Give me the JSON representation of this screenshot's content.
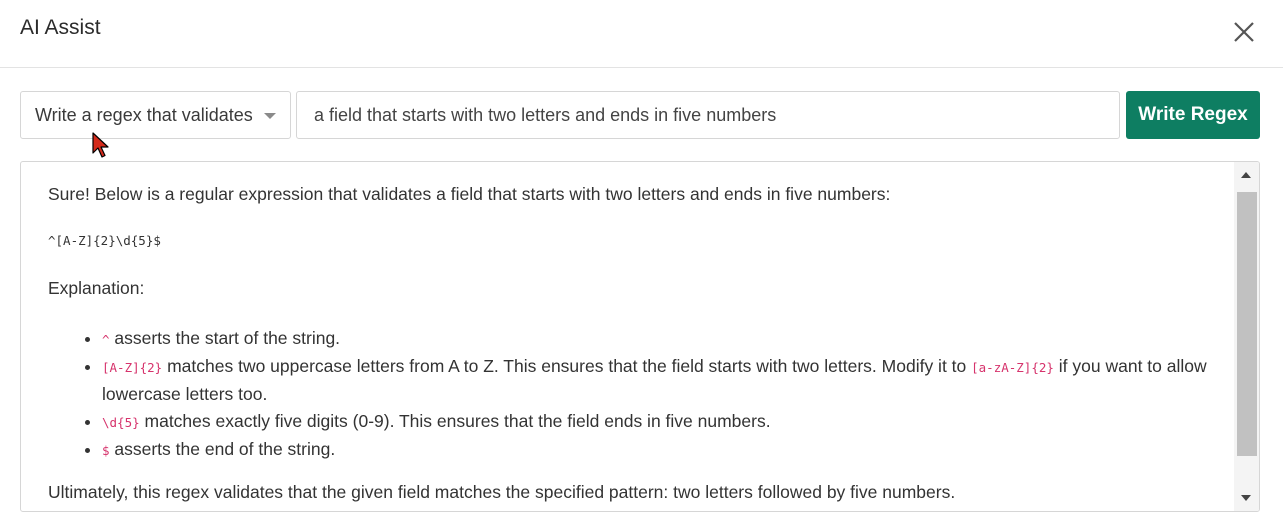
{
  "dialog": {
    "title": "AI Assist",
    "close_icon": "close-icon"
  },
  "controls": {
    "mode_select": {
      "value": "Write a regex that validates"
    },
    "prompt_input": {
      "value": "a field that starts with two letters and ends in five numbers"
    },
    "submit_label": "Write Regex",
    "accent_color": "#0e7e62"
  },
  "response": {
    "intro": "Sure! Below is a regular expression that validates a field that starts with two letters and ends in five numbers:",
    "regex": "^[A-Z]{2}\\d{5}$",
    "explanation_heading": "Explanation:",
    "bullets": [
      {
        "code": "^",
        "text": " asserts the start of the string."
      },
      {
        "code": "[A-Z]{2}",
        "text": " matches two uppercase letters from A to Z. This ensures that the field starts with two letters. Modify it to ",
        "code2": "[a-zA-Z]{2}",
        "text2": " if you want to allow lowercase letters too."
      },
      {
        "code": "\\d{5}",
        "text": " matches exactly five digits (0-9). This ensures that the field ends in five numbers."
      },
      {
        "code": "$",
        "text": " asserts the end of the string."
      }
    ],
    "conclusion": "Ultimately, this regex validates that the given field matches the specified pattern: two letters followed by five numbers."
  }
}
